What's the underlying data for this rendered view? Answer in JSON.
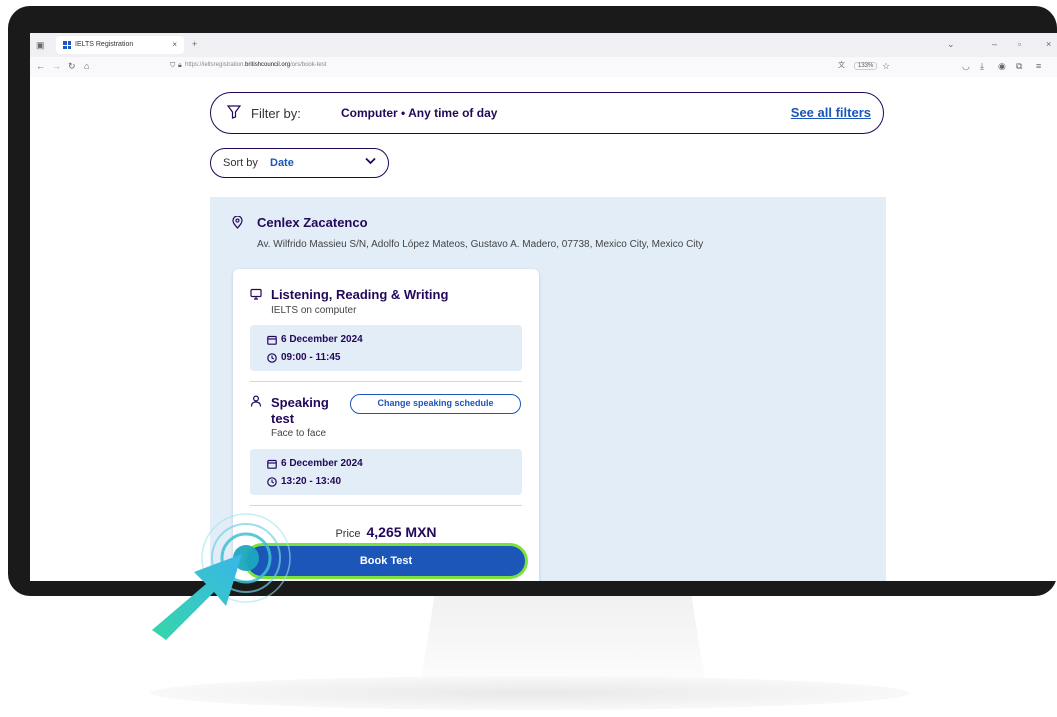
{
  "browser": {
    "tab_title": "IELTS Registration",
    "tab_close": "×",
    "new_tab": "+",
    "url_prefix": "https://ieltsregistration.",
    "url_domain": "britishcouncil.org",
    "url_path": "/ors/book-test",
    "zoom": "133%",
    "window_controls": {
      "minimize": "–",
      "maximize": "▫",
      "close": "×"
    }
  },
  "filter": {
    "label": "Filter by:",
    "value": "Computer  •  Any time of day",
    "see_all": "See all filters"
  },
  "sort": {
    "label": "Sort by",
    "value": "Date"
  },
  "centre": {
    "name": "Cenlex Zacatenco",
    "address": "Av. Wilfrido Massieu S/N, Adolfo López Mateos, Gustavo A. Madero, 07738, Mexico City, Mexico City"
  },
  "written": {
    "title": "Listening, Reading & Writing",
    "subtitle": "IELTS on computer",
    "date": "6 December 2024",
    "time": "09:00 - 11:45"
  },
  "speaking": {
    "title_line1": "Speaking",
    "title_line2": "test",
    "subtitle": "Face to face",
    "change_button": "Change speaking schedule",
    "date": "6 December 2024",
    "time": "13:20 - 13:40"
  },
  "price": {
    "label": "Price",
    "value": "4,265 MXN"
  },
  "book_button": "Book Test",
  "colors": {
    "primary": "#1b56b8",
    "dark_text": "#23085a",
    "panel_bg": "#e2edf8",
    "highlight": "#7be23c",
    "cursor": "#23c6b8"
  }
}
